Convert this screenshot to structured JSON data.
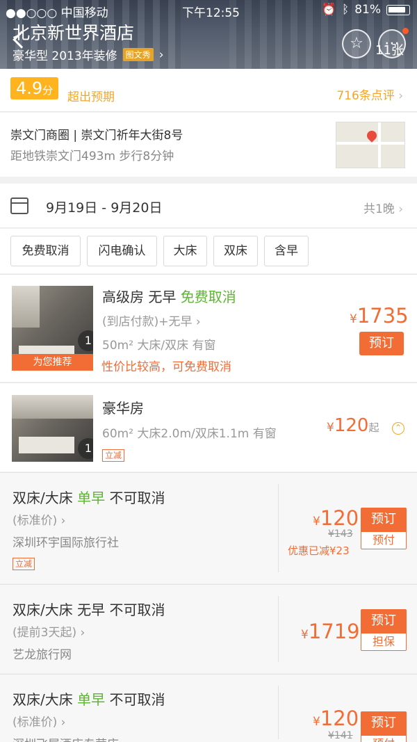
{
  "status_bar": {
    "carrier": "●●○○○ 中国移动 ",
    "time": "下午12:55",
    "battery": "81%"
  },
  "header": {
    "hotel_name": "北京新世界酒店",
    "subtitle": "豪华型 2013年装修",
    "photo_tag": "图文秀",
    "photo_count": "11张"
  },
  "rating": {
    "score": "4.9",
    "score_unit": "分",
    "score_text": "超出预期",
    "reviews": "716条点评"
  },
  "address": {
    "line1": "崇文门商圈 | 崇文门祈年大街8号",
    "line2": "距地铁崇文门493m 步行8分钟"
  },
  "dates": {
    "range": "9月19日 - 9月20日",
    "nights": "共1晚"
  },
  "filters": [
    "免费取消",
    "闪电确认",
    "大床",
    "双床",
    "含早"
  ],
  "rooms": [
    {
      "title": "高级房 无早 ",
      "title_green": "免费取消",
      "payment": "(到店付款)+无早",
      "details": "50m² 大床/双床 有窗",
      "promo": "性价比较高，可免费取消",
      "recommend": "为您推荐",
      "img_count": "1",
      "currency": "¥",
      "price": "1735",
      "book": "预订"
    },
    {
      "title": "豪华房",
      "details": "60m²  大床2.0m/双床1.1m  有窗",
      "sale_tag": "立减",
      "img_count": "1",
      "currency": "¥",
      "price": "120",
      "price_suffix": "起"
    }
  ],
  "rates": [
    {
      "bed": "双床/大床 ",
      "breakfast": "单早",
      "cancel": " 不可取消",
      "price_type": "(标准价)",
      "agency": "深圳环宇国际旅行社",
      "sale_tag": "立减",
      "currency": "¥",
      "price": "120",
      "original": "¥143",
      "discount": "优惠已减¥23",
      "book": "预订",
      "pay": "预付"
    },
    {
      "bed": "双床/大床 ",
      "breakfast_plain": "无早",
      "cancel": " 不可取消",
      "price_type": "(提前3天起)",
      "agency": "艺龙旅行网",
      "currency": "¥",
      "price": "1719",
      "book": "预订",
      "pay": "担保"
    },
    {
      "bed": "双床/大床 ",
      "breakfast": "单早",
      "cancel": " 不可取消",
      "price_type": "(标准价)",
      "agency": "深圳飞屋酒店专营店",
      "currency": "¥",
      "price": "120",
      "original": "¥141",
      "book": "预订",
      "pay": "预付"
    }
  ]
}
